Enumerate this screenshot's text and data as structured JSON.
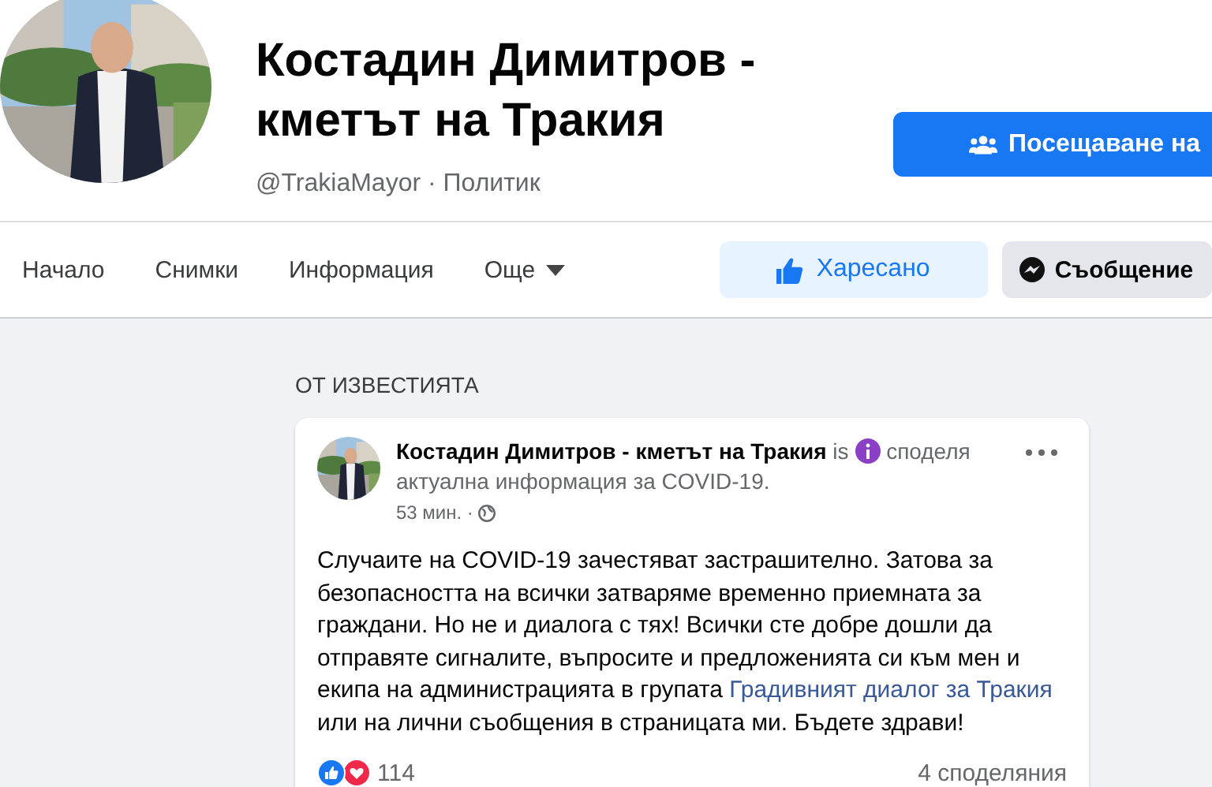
{
  "page": {
    "name": "Костадин Димитров -\nкметът на Тракия",
    "handle": "@TrakiaMayor · Политик",
    "visit_button": "Посещаване на"
  },
  "nav": {
    "tabs": [
      {
        "label": "Начало",
        "selected": false
      },
      {
        "label": "Снимки",
        "selected": false
      },
      {
        "label": "Информация",
        "selected": false
      },
      {
        "label": "Още",
        "selected": false,
        "kind": "dropdown"
      }
    ],
    "like_button": {
      "label": "Харесано",
      "on": true
    },
    "message_button": "Съобщение"
  },
  "feed": {
    "heading": "ОТ ИЗВЕСТИЯТА",
    "post": {
      "author": "Костадин Димитров - кметът на Тракия",
      "connector": "is",
      "activity": "споделя актуална информация за COVID-19.",
      "time": "53 мин. ·",
      "text_before": "Случаите на COVID-19 зачестяват застрашително. Затова за безопасността на всички затваряме временно приемната за граждани. Но не и диалога с тях! Всички сте добре дошли да отправяте сигналите, въпросите и предложенията си към мен и екипа на администрацията в групата",
      "link": "Градивният диалог за Тракия",
      "text_after": "или на лични съобщения в страницата ми. Бъдете здрави!",
      "reactions": "114",
      "shares": "4 споделяния"
    }
  }
}
